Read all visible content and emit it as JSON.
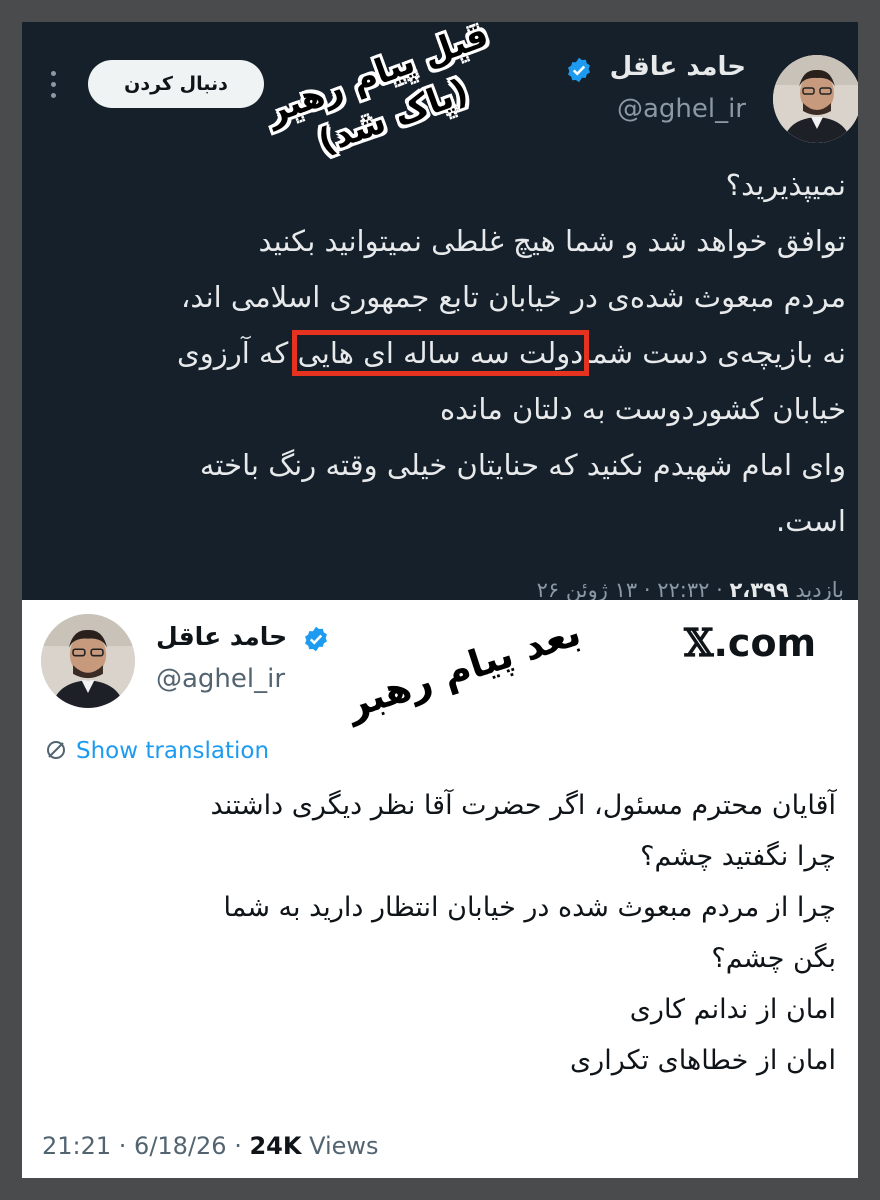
{
  "top_tweet": {
    "author_name": "حامد عاقل",
    "handle": "@aghel_ir",
    "follow_label": "دنبال کردن",
    "annotation_before": [
      "قبل پیام رهبر",
      "(پاک شد)"
    ],
    "lines": [
      "نمیپذیرید؟",
      "توافق خواهد شد و شما هیچ غلطی نمیتوانید بکنید",
      "مردم مبعوث شده‌ی در خیابان تابع جمهوری اسلامی اند،",
      "که آرزوی",
      "خیابان کشوردوست به دلتان مانده",
      "وای امام شهیدم نکنید که حنایتان خیلی وقته رنگ باخته",
      "است."
    ],
    "line4_start": "نه بازیچه‌ی دست شما",
    "highlighted_phrase": "دولت سه ساله ای هایی",
    "meta_date": "۲۲:۳۲ · ۱۳ ژوئن ۲۶",
    "meta_views_label": "بازدید",
    "meta_views": "۲،۳۹۹",
    "highlight_color": "#e53320"
  },
  "bottom_tweet": {
    "author_name": "حامد عاقل",
    "handle": "@aghel_ir",
    "site_label": ".com",
    "site_x": "𝕏",
    "annotation_after": "بعد پیام رهبر",
    "show_translation": "Show translation",
    "lines": [
      "آقایان محترم مسئول، اگر حضرت آقا نظر دیگری داشتند",
      "چرا نگفتید چشم؟",
      "چرا از مردم مبعوث شده در خیابان انتظار دارید به شما",
      "بگن چشم؟",
      "امان از ندانم کاری",
      "امان از خطاهای تکراری"
    ],
    "meta_time": "21:21 · 6/18/26 · ",
    "meta_views": "24K",
    "meta_views_label": " Views",
    "link_color": "#1d9bf0"
  },
  "icons": [
    "verified-badge-icon",
    "more-options-icon",
    "translate-icon",
    "x-logo-icon"
  ]
}
